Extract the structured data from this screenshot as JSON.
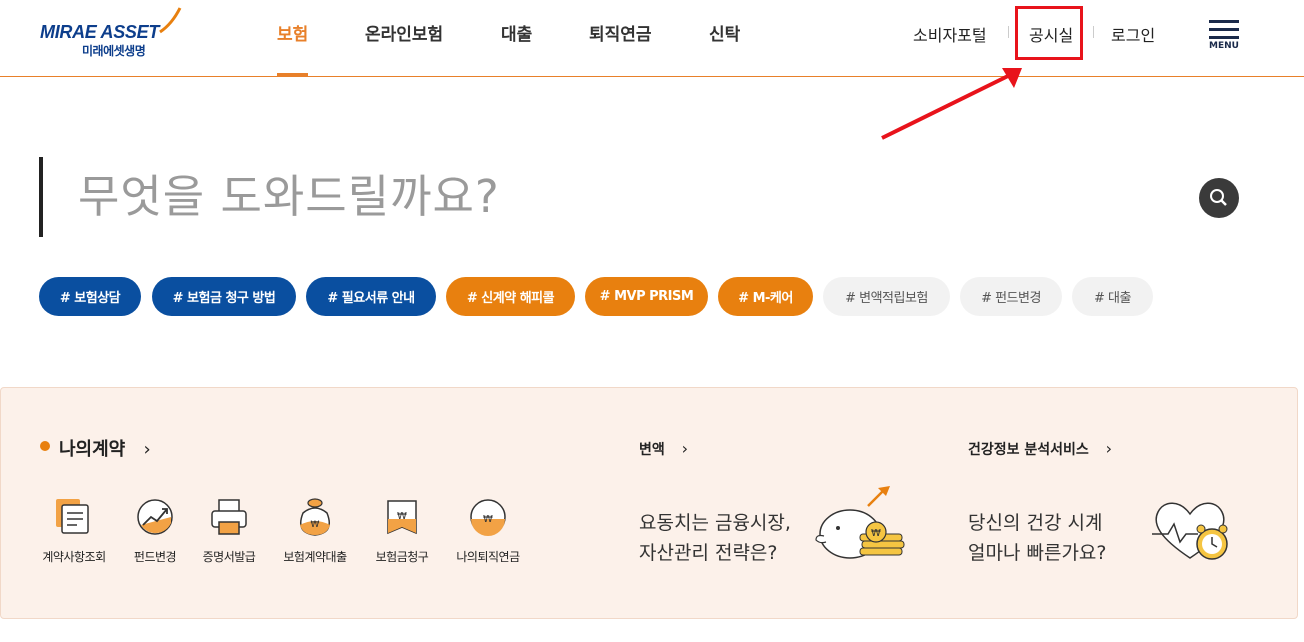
{
  "header": {
    "logo": {
      "brand": "MIRAE ASSET",
      "sub": "미래에셋생명"
    },
    "gnb": [
      "보험",
      "온라인보험",
      "대출",
      "퇴직연금",
      "신탁"
    ],
    "util": [
      "소비자포털",
      "공시실",
      "로그인"
    ],
    "menu_label": "MENU"
  },
  "search": {
    "placeholder": "무엇을 도와드릴까요?"
  },
  "tags": [
    "# 보험상담",
    "# 보험금 청구 방법",
    "# 필요서류 안내",
    "# 신계약 해피콜",
    "# MVP PRISM",
    "# M-케어",
    "# 변액적립보험",
    "# 펀드변경",
    "# 대출"
  ],
  "my_contract": {
    "title": "나의계약",
    "items": [
      "계약사항조회",
      "펀드변경",
      "증명서발급",
      "보험계약대출",
      "보험금청구",
      "나의퇴직연금"
    ]
  },
  "variable": {
    "title": "변액",
    "line1": "요동치는 금융시장,",
    "line2": "자산관리 전략은?"
  },
  "health": {
    "title": "건강정보 분석서비스",
    "line1": "당신의 건강 시계",
    "line2": "얼마나 빠른가요?"
  },
  "colors": {
    "orange": "#e8800f",
    "navy": "#0a4fa0",
    "highlight": "#e8131b"
  }
}
